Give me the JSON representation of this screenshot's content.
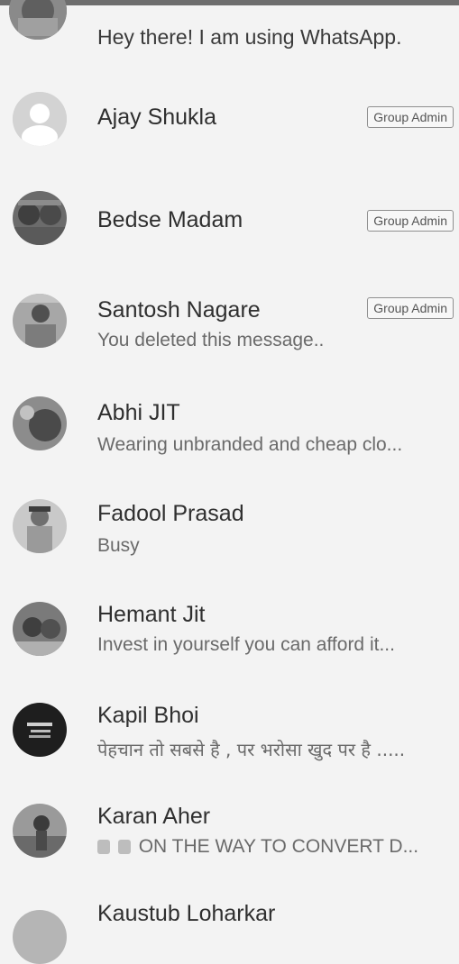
{
  "contacts": [
    {
      "name": "",
      "status": "Hey there! I am using WhatsApp.",
      "badge": ""
    },
    {
      "name": "Ajay Shukla",
      "status": "",
      "badge": "Group Admin"
    },
    {
      "name": "Bedse Madam",
      "status": "",
      "badge": "Group Admin"
    },
    {
      "name": "Santosh Nagare",
      "status": "You deleted this message..",
      "badge": "Group Admin"
    },
    {
      "name": "Abhi JIT",
      "status": "Wearing unbranded and cheap clo...",
      "badge": ""
    },
    {
      "name": "Fadool Prasad",
      "status": "Busy",
      "badge": ""
    },
    {
      "name": "Hemant Jit",
      "status": "Invest in yourself  you can afford it...",
      "badge": ""
    },
    {
      "name": "Kapil Bhoi",
      "status": "पेहचान तो सबसे है , पर भरोसा खुद पर है .....",
      "badge": ""
    },
    {
      "name": "Karan Aher",
      "status": "ON THE WAY TO CONVERT D...",
      "badge": ""
    },
    {
      "name": "Kaustub Loharkar",
      "status": "",
      "badge": ""
    }
  ],
  "colors": {
    "background": "#f3f3f3",
    "name_text": "#2f2f2f",
    "status_text": "#6a6a6a",
    "badge_border": "#8f8f8f"
  },
  "icons": [
    "avatar-photo",
    "default-avatar",
    "emoji-icons"
  ]
}
